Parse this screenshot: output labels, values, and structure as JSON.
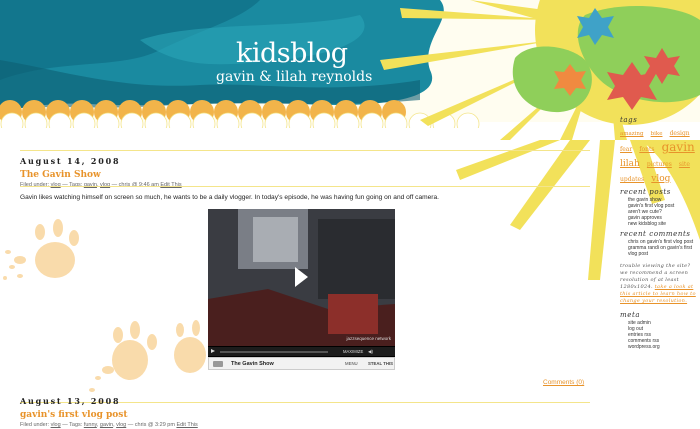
{
  "header": {
    "title": "kidsblog",
    "subtitle": "gavin & lilah reynolds"
  },
  "posts": [
    {
      "date": "August 14, 2008",
      "title": "The Gavin Show",
      "meta": {
        "filed_prefix": "Filed under:",
        "category": "vlog",
        "tags_prefix": "— Tags:",
        "tags": [
          "gavin",
          "vlog"
        ],
        "author": "— chris @ 9:46 am",
        "edit": "Edit This"
      },
      "body": "Gavin likes watching  himself on screen so much, he wants to be a daily vlogger.  In today's episode, he was having fun going on and off camera.",
      "video": {
        "title": "The Gavin Show",
        "network_label": "jazzsequence network",
        "maximize_label": "MAXIMIZE",
        "menu_label": "MENU",
        "steal_label": "STEAL THIS"
      },
      "comments_link": "Comments (0)"
    },
    {
      "date": "August 13, 2008",
      "title": "gavin's first vlog post",
      "meta": {
        "filed_prefix": "Filed under:",
        "category": "vlog",
        "tags_prefix": "— Tags:",
        "tags": [
          "funny",
          "gavin",
          "vlog"
        ],
        "author": "— chris @ 3:29 pm",
        "edit": "Edit This"
      }
    }
  ],
  "sidebar": {
    "tags_heading": "tags",
    "tags": [
      "amazing",
      "bike",
      "design",
      "fear",
      "fonts",
      "gavin",
      "lilah",
      "pictures",
      "site",
      "updates",
      "vlog"
    ],
    "recent_posts_heading": "recent posts",
    "recent_posts": [
      "the gavin show",
      "gavin's first vlog post",
      "aren't we cute?",
      "gavin approves",
      "new kidsblog site"
    ],
    "recent_comments_heading": "recent comments",
    "recent_comments": [
      "chris on gavin's first vlog post",
      "gramma randi on gavin's first vlog post"
    ],
    "notice_text": "trouble viewing the site? we recommend a screen resolution of at least 1280x1024.",
    "notice_link": "take a look at this article to learn how to change your resolution.",
    "meta_heading": "meta",
    "meta_links": [
      "site admin",
      "log out",
      "entries rss",
      "comments rss",
      "wordpress.org"
    ]
  },
  "colors": {
    "accent": "#e8932a",
    "teal": "#1a8aa0",
    "sun": "#f2e15a",
    "flower_red": "#e05a4e",
    "flower_orange": "#f08a40",
    "flower_blue": "#3fa2c8"
  }
}
